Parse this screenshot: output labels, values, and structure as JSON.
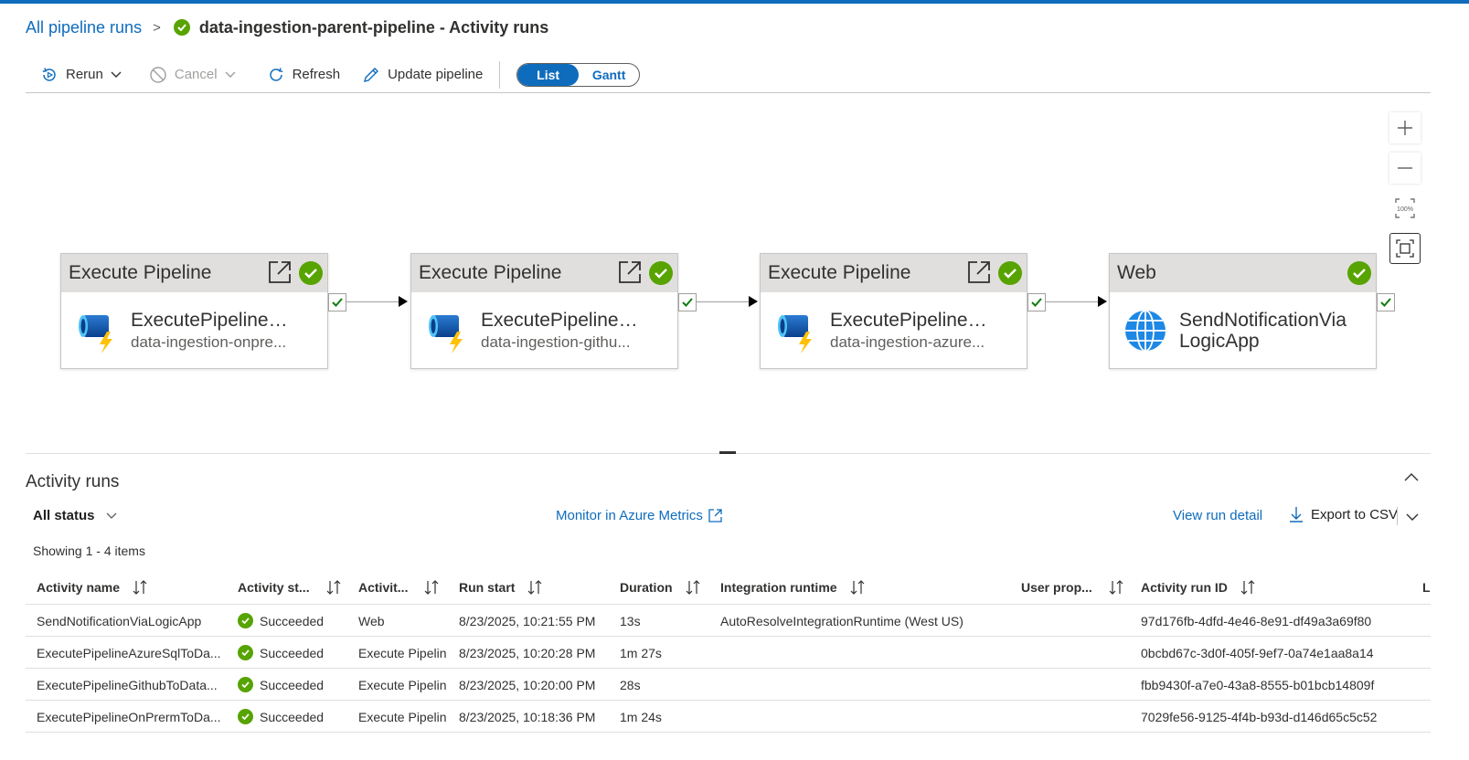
{
  "breadcrumb": {
    "parent": "All pipeline runs",
    "separator": ">",
    "title": "data-ingestion-parent-pipeline - Activity runs"
  },
  "toolbar": {
    "rerun": "Rerun",
    "cancel": "Cancel",
    "refresh": "Refresh",
    "update": "Update pipeline",
    "view_list": "List",
    "view_gantt": "Gantt"
  },
  "canvas": {
    "zoom_reset_label": "100%",
    "nodes": [
      {
        "type": "Execute Pipeline",
        "name": "ExecutePipelineO...",
        "sub": "data-ingestion-onpre..."
      },
      {
        "type": "Execute Pipeline",
        "name": "ExecutePipelineGi...",
        "sub": "data-ingestion-githu..."
      },
      {
        "type": "Execute Pipeline",
        "name": "ExecutePipelineAz...",
        "sub": "data-ingestion-azure..."
      },
      {
        "type": "Web",
        "name": "SendNotificationViaLogicApp"
      }
    ]
  },
  "activity_runs": {
    "title": "Activity runs",
    "status_filter": "All status",
    "monitor_link": "Monitor in Azure Metrics",
    "view_detail": "View run detail",
    "export": "Export to CSV",
    "showing": "Showing 1 - 4 items",
    "columns": {
      "name": "Activity name",
      "status": "Activity st...",
      "type": "Activit...",
      "start": "Run start",
      "duration": "Duration",
      "runtime": "Integration runtime",
      "user": "User prop...",
      "runid": "Activity run ID",
      "extra": "L"
    },
    "rows": [
      {
        "name": "SendNotificationViaLogicApp",
        "status": "Succeeded",
        "type": "Web",
        "start": "8/23/2025, 10:21:55 PM",
        "duration": "13s",
        "runtime": "AutoResolveIntegrationRuntime (West US)",
        "runid": "97d176fb-4dfd-4e46-8e91-df49a3a69f80"
      },
      {
        "name": "ExecutePipelineAzureSqlToDa...",
        "status": "Succeeded",
        "type": "Execute Pipeline",
        "start": "8/23/2025, 10:20:28 PM",
        "duration": "1m 27s",
        "runtime": "",
        "runid": "0bcbd67c-3d0f-405f-9ef7-0a74e1aa8a14"
      },
      {
        "name": "ExecutePipelineGithubToData...",
        "status": "Succeeded",
        "type": "Execute Pipeline",
        "start": "8/23/2025, 10:20:00 PM",
        "duration": "28s",
        "runtime": "",
        "runid": "fbb9430f-a7e0-43a8-8555-b01bcb14809f"
      },
      {
        "name": "ExecutePipelineOnPrermToDa...",
        "status": "Succeeded",
        "type": "Execute Pipeline",
        "start": "8/23/2025, 10:18:36 PM",
        "duration": "1m 24s",
        "runtime": "",
        "runid": "7029fe56-9125-4f4b-b93d-d146d65c5c52"
      }
    ]
  },
  "colors": {
    "accent": "#0f6cbd",
    "success": "#57a300"
  }
}
